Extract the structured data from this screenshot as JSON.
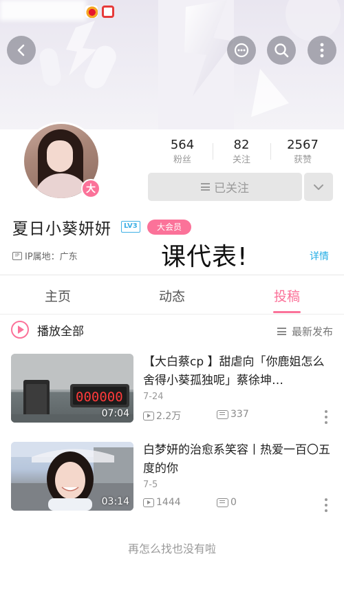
{
  "profile": {
    "username": "夏日小葵妍妍",
    "level": "LV3",
    "vip": "大会员",
    "avatar_badge": "大",
    "ip_icon": "IP",
    "ip_location": "IP属地：广东",
    "overlay_text": "课代表!",
    "detail_link": "详情"
  },
  "stats": [
    {
      "value": "564",
      "label": "粉丝"
    },
    {
      "value": "82",
      "label": "关注"
    },
    {
      "value": "2567",
      "label": "获赞"
    }
  ],
  "follow_button": {
    "label": "已关注"
  },
  "tabs": [
    {
      "label": "主页",
      "active": false
    },
    {
      "label": "动态",
      "active": false
    },
    {
      "label": "投稿",
      "active": true
    }
  ],
  "play_all": {
    "label": "播放全部"
  },
  "sort": {
    "label": "最新发布"
  },
  "videos": [
    {
      "title": "【大白蔡cp 】甜虐向「你鹿姐怎么舍得小葵孤独呢」蔡徐坤…",
      "date": "7-24",
      "plays": "2.2万",
      "danmaku": "337",
      "duration": "07:04"
    },
    {
      "title": "白梦妍的治愈系笑容丨热爱一百〇五度的你",
      "date": "7-5",
      "plays": "1444",
      "danmaku": "0",
      "duration": "03:14"
    }
  ],
  "footer_note": "再怎么找也没有啦",
  "colors": {
    "accent": "#fb7299",
    "link": "#23ade5",
    "level_badge": "#3eb0e5"
  },
  "icons": {
    "back": "back-arrow-icon",
    "message": "message-bubble-icon",
    "search": "search-icon",
    "more": "more-vertical-icon"
  }
}
